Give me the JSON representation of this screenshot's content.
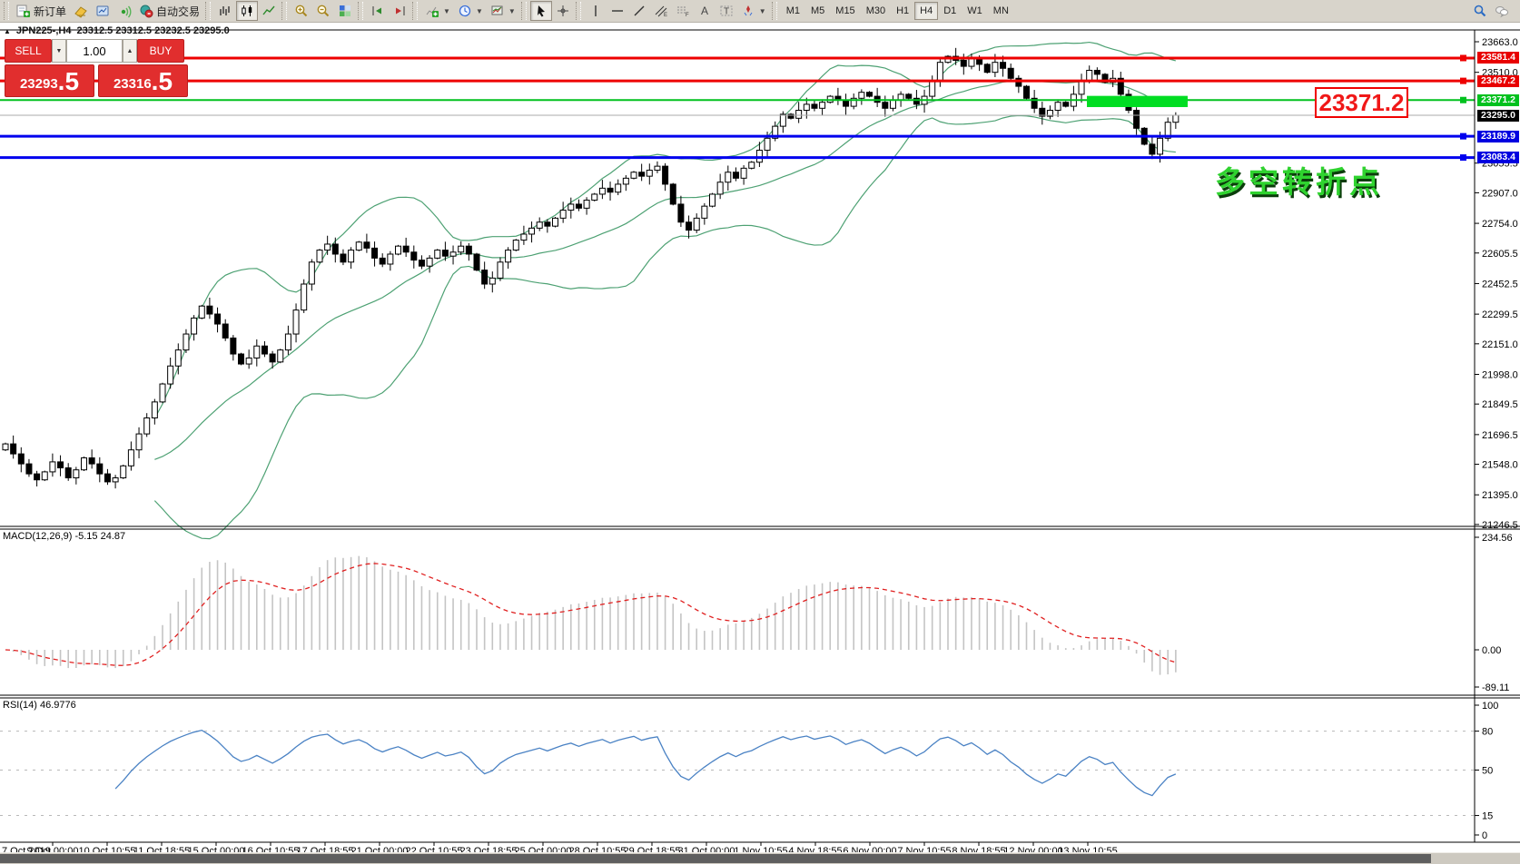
{
  "toolbar": {
    "new_order_label": "新订单",
    "autotrade_label": "自动交易",
    "timeframes": [
      "M1",
      "M5",
      "M15",
      "M30",
      "H1",
      "H4",
      "D1",
      "W1",
      "MN"
    ],
    "active_timeframe": "H4"
  },
  "chart": {
    "title_text": "JPN225-,H4",
    "ohlc_text": "23312.5 23312.5 23232.5 23295.0"
  },
  "one_click": {
    "sell_label": "SELL",
    "buy_label": "BUY",
    "volume": "1.00",
    "sell_price_main": "23293",
    "sell_price_big": ".5",
    "buy_price_main": "23316",
    "buy_price_big": ".5"
  },
  "annotations": {
    "level_callout": "23371.2",
    "turning_point": "多空转折点",
    "highlight_rect": {
      "price_top": 23392,
      "price_bottom": 23336
    }
  },
  "indicators": {
    "macd_label": "MACD(12,26,9) -5.15 24.87",
    "rsi_label": "RSI(14) 46.9776"
  },
  "price_axis": {
    "ticks": [
      23663.0,
      23510.0,
      23055.5,
      22907.0,
      22754.0,
      22605.5,
      22452.5,
      22299.5,
      22151.0,
      21998.0,
      21849.5,
      21696.5,
      21548.0,
      21395.0,
      21246.5
    ],
    "levels": [
      {
        "label": "23581.4",
        "value": 23581.4,
        "color": "#ee0000",
        "badge": "#e80000",
        "width": 3
      },
      {
        "label": "23467.2",
        "value": 23467.2,
        "color": "#ee0000",
        "badge": "#e80000",
        "width": 3
      },
      {
        "label": "23371.2",
        "value": 23371.2,
        "color": "#00c11e",
        "badge": "#00c11e",
        "width": 2
      },
      {
        "label": "23295.0",
        "value": 23295.0,
        "color": "#ababab",
        "badge": "#000000",
        "width": 1
      },
      {
        "label": "23189.9",
        "value": 23189.9,
        "color": "#0000ee",
        "badge": "#0000e0",
        "width": 3
      },
      {
        "label": "23083.4",
        "value": 23083.4,
        "color": "#0000ee",
        "badge": "#0000e0",
        "width": 3
      }
    ]
  },
  "macd_axis": [
    "234.56",
    "0.00",
    "-89.11"
  ],
  "rsi_axis": [
    {
      "label": "100",
      "value": 100,
      "dashed": false
    },
    {
      "label": "80",
      "value": 80,
      "dashed": true
    },
    {
      "label": "50",
      "value": 50,
      "dashed": true
    },
    {
      "label": "15",
      "value": 15,
      "dashed": true
    },
    {
      "label": "0",
      "value": 0,
      "dashed": false
    }
  ],
  "time_axis": {
    "first_label": "7 Oct 2019",
    "labels": [
      "9 Oct 00:00",
      "10 Oct 10:55",
      "11 Oct 18:55",
      "15 Oct 00:00",
      "16 Oct 10:55",
      "17 Oct 18:55",
      "21 Oct 00:00",
      "22 Oct 10:55",
      "23 Oct 18:55",
      "25 Oct 00:00",
      "28 Oct 10:55",
      "29 Oct 18:55",
      "31 Oct 00:00",
      "1 Nov 10:55",
      "4 Nov 18:55",
      "6 Nov 00:00",
      "7 Nov 10:55",
      "8 Nov 18:55",
      "12 Nov 00:00",
      "13 Nov 10:55"
    ]
  },
  "chart_data": {
    "type": "candlestick",
    "symbol": "JPN225",
    "period": "H4",
    "bollinger_period": 20,
    "bollinger_dev": 2,
    "macd_params": [
      12,
      26,
      9
    ],
    "rsi_period": 14,
    "closes": [
      21650,
      21600,
      21550,
      21500,
      21470,
      21510,
      21560,
      21530,
      21480,
      21520,
      21580,
      21550,
      21500,
      21460,
      21480,
      21540,
      21620,
      21700,
      21780,
      21860,
      21950,
      22040,
      22120,
      22200,
      22280,
      22340,
      22300,
      22250,
      22180,
      22100,
      22050,
      22080,
      22140,
      22100,
      22060,
      22120,
      22200,
      22320,
      22450,
      22560,
      22620,
      22650,
      22600,
      22560,
      22620,
      22660,
      22630,
      22580,
      22550,
      22600,
      22640,
      22610,
      22570,
      22540,
      22580,
      22620,
      22590,
      22610,
      22640,
      22600,
      22520,
      22450,
      22480,
      22560,
      22620,
      22670,
      22700,
      22730,
      22760,
      22740,
      22780,
      22820,
      22850,
      22830,
      22870,
      22900,
      22930,
      22910,
      22950,
      22980,
      23010,
      22990,
      23020,
      23040,
      22950,
      22850,
      22760,
      22720,
      22780,
      22840,
      22900,
      22960,
      23010,
      22980,
      23030,
      23060,
      23120,
      23180,
      23240,
      23300,
      23280,
      23320,
      23350,
      23330,
      23360,
      23390,
      23370,
      23340,
      23380,
      23410,
      23390,
      23360,
      23330,
      23370,
      23400,
      23380,
      23350,
      23390,
      23470,
      23560,
      23590,
      23570,
      23540,
      23580,
      23550,
      23510,
      23560,
      23530,
      23480,
      23440,
      23380,
      23330,
      23290,
      23320,
      23360,
      23340,
      23400,
      23470,
      23520,
      23500,
      23460,
      23480,
      23400,
      23320,
      23230,
      23150,
      23100,
      23180,
      23260,
      23295
    ]
  }
}
